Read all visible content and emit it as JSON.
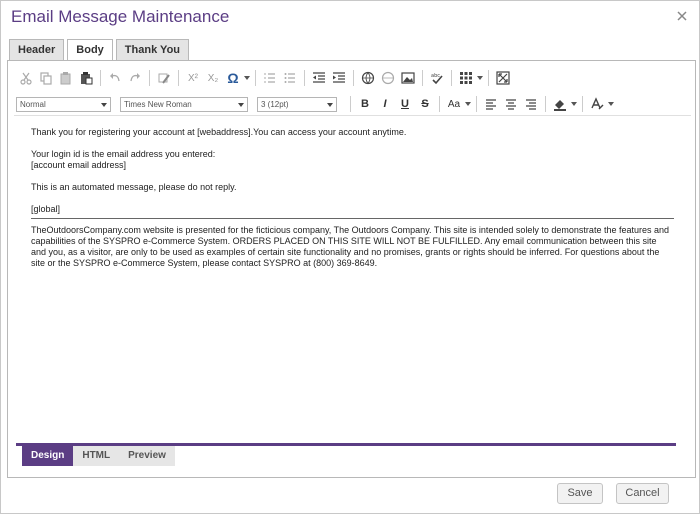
{
  "dialog": {
    "title": "Email Message Maintenance",
    "accent_color": "#5b3d84"
  },
  "tabs": [
    {
      "label": "Header",
      "active": false
    },
    {
      "label": "Body",
      "active": true
    },
    {
      "label": "Thank You",
      "active": false
    }
  ],
  "toolbar": {
    "format_select": "Normal",
    "font_select": "Times New Roman",
    "size_select": "3 (12pt)",
    "bold": "B",
    "italic": "I",
    "underline": "U",
    "strike": "S",
    "case": "Aa",
    "superscript": "X²",
    "subscript": "X₂",
    "omega": "Ω"
  },
  "content": {
    "line1": "Thank you for registering your account at [webaddress].You can access your account anytime.",
    "line2": "Your login id is the email address you entered:",
    "line3": "[account email address]",
    "line4": "This is an automated message, please do not reply.",
    "line5": "[global]",
    "disclaimer": "TheOutdoorsCompany.com website is presented for the ficticious company, The Outdoors Company. This site is intended solely to demonstrate the features and capabilities of the SYSPRO e-Commerce System. ORDERS PLACED ON THIS SITE WILL NOT BE FULFILLED. Any email communication between this site and you, as a visitor, are only to be used as examples of certain site functionality and no promises, grants or rights should be inferred. For questions about the site or the SYSPRO e-Commerce System, please contact SYSPRO at (800) 369-8649."
  },
  "editor_tabs": [
    {
      "label": "Design",
      "active": true
    },
    {
      "label": "HTML",
      "active": false
    },
    {
      "label": "Preview",
      "active": false
    }
  ],
  "footer": {
    "save": "Save",
    "cancel": "Cancel"
  }
}
